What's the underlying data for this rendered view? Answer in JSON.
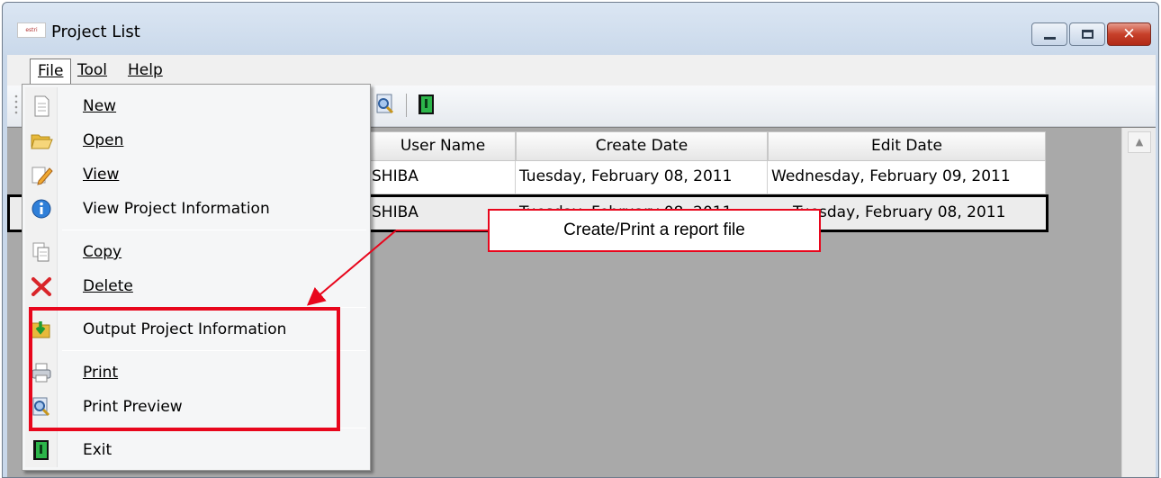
{
  "window": {
    "title": "Project List",
    "app_icon_text": "estri",
    "controls": {
      "minimize": "minimize",
      "maximize": "maximize",
      "close": "✕"
    }
  },
  "menubar": {
    "file": {
      "label": "File"
    },
    "tool": {
      "label": "Tool"
    },
    "help": {
      "label": "Help"
    }
  },
  "file_menu": {
    "items": [
      {
        "label": "New",
        "icon": "new-document-icon"
      },
      {
        "label": "Open",
        "icon": "folder-open-icon"
      },
      {
        "label": "View",
        "icon": "edit-pencil-icon"
      },
      {
        "label": "View Project Information",
        "icon": "info-icon"
      },
      {
        "label": "Copy",
        "icon": "copy-icon"
      },
      {
        "label": "Delete",
        "icon": "delete-x-icon"
      },
      {
        "label": "Output Project Information",
        "icon": "export-folder-icon"
      },
      {
        "label": "Print",
        "icon": "printer-icon"
      },
      {
        "label": "Print Preview",
        "icon": "print-preview-icon"
      },
      {
        "label": "Exit",
        "icon": "exit-door-icon"
      }
    ]
  },
  "grid": {
    "columns": [
      "User Name",
      "Create Date",
      "Edit Date"
    ],
    "rows": [
      [
        "SHIBA",
        "Tuesday, February 08, 2011",
        "Wednesday, February 09, 2011"
      ],
      [
        "SHIBA",
        "Tuesday, February 08, 2011",
        "Tuesday, February 08, 2011"
      ]
    ]
  },
  "annotation": {
    "callout_text": "Create/Print a report file",
    "color": "#e8061c"
  }
}
